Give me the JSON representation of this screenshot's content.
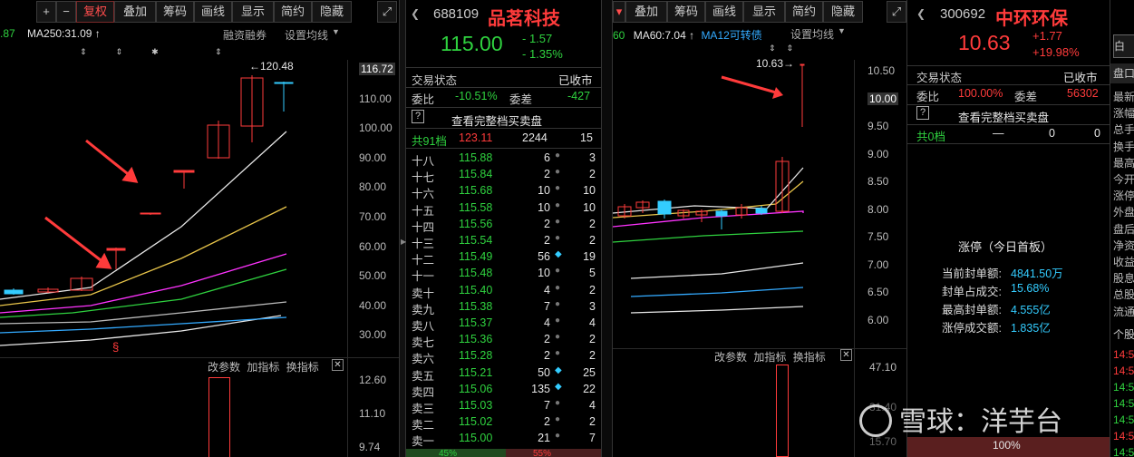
{
  "left_chart": {
    "toolbar": [
      "+",
      "−",
      "复权",
      "叠加",
      "筹码",
      "画线",
      "显示",
      "简约",
      "隐藏"
    ],
    "ma_labels": [
      {
        "text": ".87",
        "color": "#2fd23f"
      },
      {
        "text": "MA250:31.09",
        "color": "#e6e6e6"
      }
    ],
    "links": {
      "margin": "融资融券",
      "ma_setting": "设置均线"
    },
    "peak_label": "←120.48",
    "y_axis": [
      "116.72",
      "110.00",
      "100.00",
      "90.00",
      "80.00",
      "70.00",
      "60.00",
      "50.00",
      "40.00",
      "30.00"
    ],
    "sub_links": [
      "改参数",
      "加指标",
      "换指标"
    ],
    "sub_axis": [
      "12.60",
      "11.10",
      "9.74"
    ],
    "marker_s": "§"
  },
  "mid_quote": {
    "code": "688109",
    "name": "品茗科技",
    "price": "115.00",
    "change": "- 1.57",
    "change_pct": "- 1.35%",
    "status_label": "交易状态",
    "status_value": "已收市",
    "ratio_label": "委比",
    "ratio_value": "-10.51%",
    "diff_label": "委差",
    "diff_value": "-427",
    "full_book": "查看完整档买卖盘",
    "summary": {
      "label": "共91档",
      "price": "123.11",
      "vol": "2244",
      "cnt": "15"
    },
    "rows": [
      {
        "label": "十八",
        "price": "115.88",
        "vol": "6",
        "cnt": "3"
      },
      {
        "label": "十七",
        "price": "115.84",
        "vol": "2",
        "cnt": "2"
      },
      {
        "label": "十六",
        "price": "115.68",
        "vol": "10",
        "cnt": "10"
      },
      {
        "label": "十五",
        "price": "115.58",
        "vol": "10",
        "cnt": "10"
      },
      {
        "label": "十四",
        "price": "115.56",
        "vol": "2",
        "cnt": "2"
      },
      {
        "label": "十三",
        "price": "115.54",
        "vol": "2",
        "cnt": "2"
      },
      {
        "label": "十二",
        "price": "115.49",
        "vol": "56",
        "cnt": "19"
      },
      {
        "label": "十一",
        "price": "115.48",
        "vol": "10",
        "cnt": "5"
      },
      {
        "label": "卖十",
        "price": "115.40",
        "vol": "4",
        "cnt": "2"
      },
      {
        "label": "卖九",
        "price": "115.38",
        "vol": "7",
        "cnt": "3"
      },
      {
        "label": "卖八",
        "price": "115.37",
        "vol": "4",
        "cnt": "4"
      },
      {
        "label": "卖七",
        "price": "115.36",
        "vol": "2",
        "cnt": "2"
      },
      {
        "label": "卖六",
        "price": "115.28",
        "vol": "2",
        "cnt": "2"
      },
      {
        "label": "卖五",
        "price": "115.21",
        "vol": "50",
        "cnt": "25"
      },
      {
        "label": "卖四",
        "price": "115.06",
        "vol": "135",
        "cnt": "22"
      },
      {
        "label": "卖三",
        "price": "115.03",
        "vol": "7",
        "cnt": "4"
      },
      {
        "label": "卖二",
        "price": "115.02",
        "vol": "2",
        "cnt": "2"
      },
      {
        "label": "卖一",
        "price": "115.00",
        "vol": "21",
        "cnt": "7"
      }
    ],
    "bottom_pct": [
      "45%",
      "55%"
    ]
  },
  "right_chart": {
    "toolbar": [
      "叠加",
      "筹码",
      "画线",
      "显示",
      "简约",
      "隐藏"
    ],
    "ma_labels": [
      {
        "text": "60",
        "color": "#2fd23f"
      },
      {
        "text": "MA60:7.04",
        "color": "#e6e6e6"
      },
      {
        "text": "MA12可转债",
        "color": "#33aaff"
      }
    ],
    "ma_setting": "设置均线",
    "peak_label": "10.63→",
    "y_axis": [
      "10.50",
      "10.00",
      "9.50",
      "9.00",
      "8.50",
      "8.00",
      "7.50",
      "7.00",
      "6.50",
      "6.00"
    ],
    "sub_links": [
      "改参数",
      "加指标",
      "换指标"
    ],
    "sub_axis": [
      "47.10",
      "31.40",
      "15.70"
    ]
  },
  "right_quote": {
    "code": "300692",
    "name": "中环环保",
    "price": "10.63",
    "change": "+1.77",
    "change_pct": "+19.98%",
    "side_tab": "盘口",
    "side_items": [
      "最新",
      "涨幅",
      "总手",
      "换手",
      "最高",
      "今开",
      "涨停",
      "外盘",
      "盘后",
      "净资",
      "收益",
      "股息",
      "总股",
      "流通"
    ],
    "side_header": "个股",
    "side_nums": [
      "14:5",
      "14:5",
      "14:5",
      "14:5",
      "14:5",
      "14:5",
      "14:5"
    ],
    "status_label": "交易状态",
    "status_value": "已收市",
    "ratio_label": "委比",
    "ratio_value": "100.00%",
    "diff_label": "委差",
    "diff_value": "56302",
    "full_book": "查看完整档买卖盘",
    "summary": {
      "label": "共0档",
      "price": "—",
      "vol": "0",
      "cnt": "0"
    },
    "limit_title": "涨停（今日首板）",
    "limit_rows": [
      {
        "label": "当前封单额:",
        "value": "4841.50万"
      },
      {
        "label": "封单占成交:",
        "value": "15.68%"
      },
      {
        "label": "最高封单额:",
        "value": "4.555亿"
      },
      {
        "label": "涨停成交额:",
        "value": "1.835亿"
      }
    ],
    "bottom_pct": "100%"
  },
  "watermark": {
    "brand": "雪球",
    "sep": "：",
    "author": "洋芋台"
  }
}
